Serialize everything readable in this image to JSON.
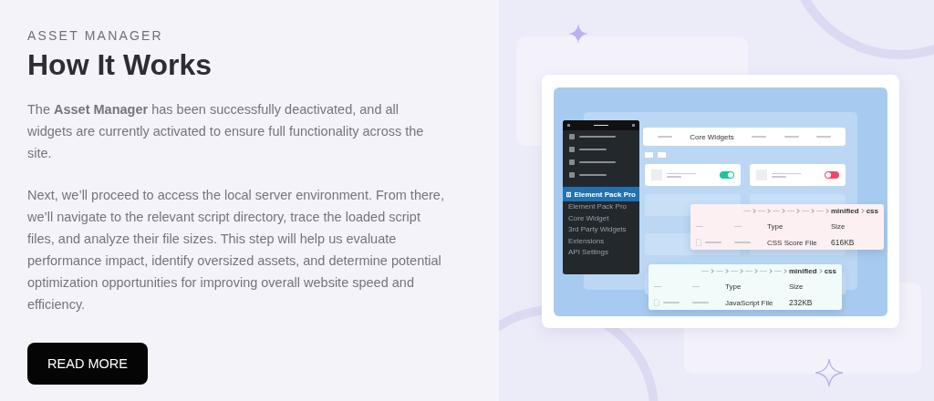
{
  "eyebrow": "ASSET MANAGER",
  "title": "How It Works",
  "paragraphs": [
    "The **Asset Manager** has been successfully deactivated, and all widgets are currently activated to ensure full functionality across the site.",
    "Next, we’ll proceed to access the local server environment. From there, we’ll navigate to the relevant script directory, trace the loaded script files, and analyze their file sizes. This step will help us evaluate performance impact, identify oversized assets, and determine potential optimization opportunities for improving overall website speed and efficiency."
  ],
  "button": "READ MORE",
  "illustration": {
    "tabs_bar": {
      "label": "Core Widgets"
    },
    "sidebar": {
      "active_item": "Element Pack Pro",
      "submenu": [
        "Element Pack Pro",
        "Core Widget",
        "3rd Party Widgets",
        "Extensions",
        "API Settings"
      ]
    },
    "widgets": [
      {
        "on": true
      },
      {
        "on": false
      }
    ],
    "file_cards": [
      {
        "path": [
          "minified",
          "css"
        ],
        "headers": [
          "Type",
          "Size"
        ],
        "type": "CSS Score File",
        "size": "616KB",
        "color": "#fdf0f3"
      },
      {
        "path": [
          "minified",
          "css"
        ],
        "headers": [
          "Type",
          "Size"
        ],
        "type": "JavaScript File",
        "size": "232KB",
        "color": "#f0fbfa"
      }
    ]
  }
}
